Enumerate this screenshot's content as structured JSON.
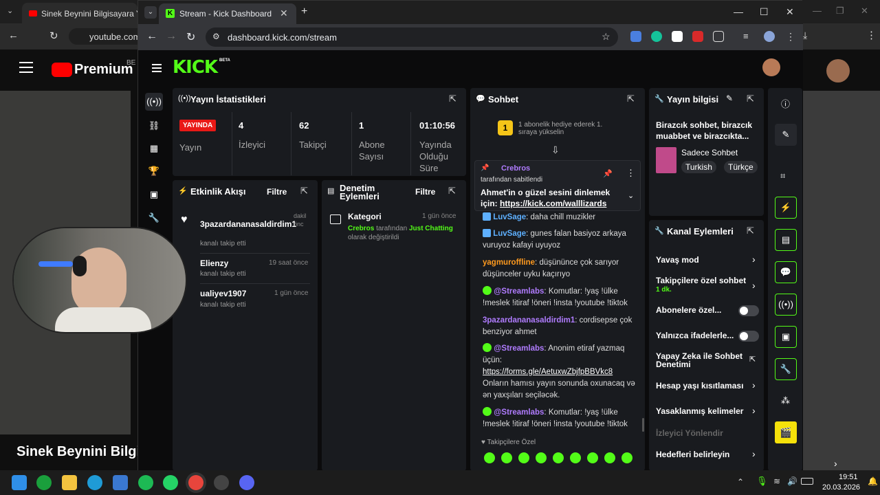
{
  "bg_window": {
    "tab_title": "Sinek Beynini Bilgisayara Yükle",
    "url": "youtube.com",
    "brand": "Premium",
    "brand_badge": "BE",
    "video_title": "Sinek Beynini Bilgis"
  },
  "window": {
    "tab_title": "Stream - Kick Dashboard",
    "url": "dashboard.kick.com/stream"
  },
  "kick": {
    "logo": "KICK",
    "beta": "BETA"
  },
  "stats": {
    "title": "Yayın İstatistikleri",
    "live_badge": "YAYINDA",
    "live_label": "Yayın",
    "items": [
      {
        "value": "4",
        "label": "İzleyici"
      },
      {
        "value": "62",
        "label": "Takipçi"
      },
      {
        "value": "1",
        "label": "Abone Sayısı"
      },
      {
        "value": "01:10:56",
        "label": "Yayında Olduğu Süre"
      }
    ]
  },
  "activity": {
    "title": "Etkinlik Akışı",
    "filter": "Filtre",
    "items": [
      {
        "user": "3pazardananasaldirdim1",
        "time": "dakil önc",
        "desc": "kanalı takip etti"
      },
      {
        "user": "Elienzy",
        "time": "19 saat önce",
        "desc": "kanalı takip etti"
      },
      {
        "user": "ualiyev1907",
        "time": "1 gün önce",
        "desc": "kanalı takip etti"
      }
    ]
  },
  "moderation": {
    "title": "Denetim Eylemleri",
    "filter": "Filtre",
    "item": {
      "label": "Kategori",
      "time": "1 gün önce",
      "user": "Crebros",
      "mid": "tarafından",
      "category": "Just Chatting",
      "tail": "olarak değiştirildi"
    }
  },
  "chat": {
    "title": "Sohbet",
    "gift_rank": "1",
    "gift_text": "1 abonelik hediye ederek 1. sıraya yükselin",
    "pinned": {
      "user": "Crebros",
      "pinned_by": "tarafından sabitlendi",
      "text": "Ahmet'in o güzel sesini dinlemek için:",
      "link": "https://kick.com/walllizards"
    },
    "messages": [
      {
        "user": "LuvSage",
        "color": "#5eb0ff",
        "text": "daha chill muzikler"
      },
      {
        "user": "LuvSage",
        "color": "#5eb0ff",
        "text": "gunes falan basiyoz arkaya vuruyoz kafayi uyuyoz"
      },
      {
        "user": "yagmuroffline",
        "color": "#ff9a1f",
        "text": "düşününce çok sarıyor düşünceler uyku kaçırıyo"
      },
      {
        "user": "@Streamlabs",
        "color": "#b07cff",
        "text": "Komutlar: !yaş !ülke !meslek !itiraf !öneri !insta !youtube !tiktok"
      },
      {
        "user": "3pazardananasaldirdim1",
        "color": "#b07cff",
        "text": "cordisepse çok benziyor ahmet"
      },
      {
        "user": "@Streamlabs",
        "color": "#b07cff",
        "text": "Anonim etiraf yazmaq üçün:"
      },
      {
        "user": "@Streamlabs",
        "color": "#b07cff",
        "text": "Komutlar: !yaş !ülke !meslek !itiraf !öneri !insta !youtube !tiktok"
      }
    ],
    "anon_link": "https://forms.gle/AetuxwZbjfpBBVkc8",
    "anon_tail": "Onların hamısı yayın sonunda oxunacaq və ən yaxşıları seçiləcək.",
    "followers_only": "Takipçilere Özel"
  },
  "stream_info": {
    "title": "Yayın bilgisi",
    "stream_title": "Birazcık sohbet, birazcık muabbet ve birazcıkta...",
    "category": "Sadece Sohbet",
    "tags": [
      "Turkish",
      "Türkçe"
    ]
  },
  "channel_actions": {
    "title": "Kanal Eylemleri",
    "items": [
      {
        "label": "Yavaş mod",
        "kind": "chevron"
      },
      {
        "label": "Takipçilere özel sohbet",
        "sub": "1 dk.",
        "kind": "chevron"
      },
      {
        "label": "Abonelere özel...",
        "kind": "toggle"
      },
      {
        "label": "Yalnızca ifadelerle...",
        "kind": "toggle"
      },
      {
        "label": "Yapay Zeka ile Sohbet Denetimi",
        "kind": "external"
      },
      {
        "label": "Hesap yaşı kısıtlaması",
        "kind": "chevron"
      },
      {
        "label": "Yasaklanmış kelimeler",
        "kind": "chevron"
      },
      {
        "label": "İzleyici Yönlendir",
        "kind": "disabled"
      },
      {
        "label": "Hedefleri belirleyin",
        "kind": "chevron"
      }
    ]
  },
  "taskbar": {
    "time": "19:51",
    "date": "20.03.2026"
  }
}
